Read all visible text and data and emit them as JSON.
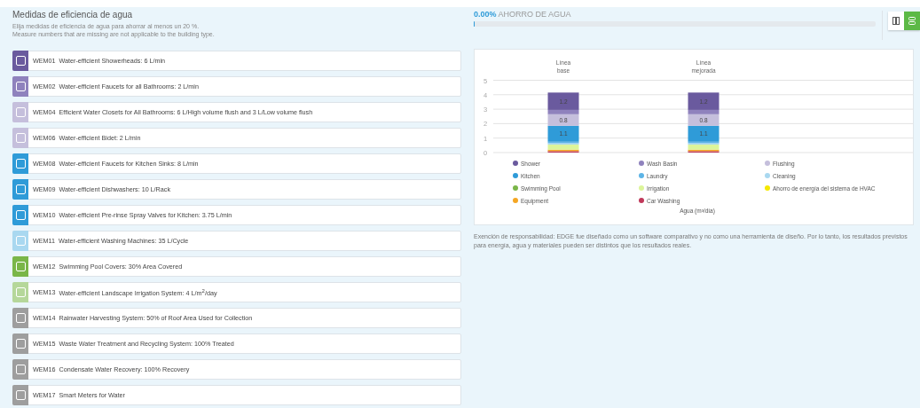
{
  "measures_panel": {
    "title": "Medidas de eficiencia de agua",
    "instructions": [
      "Elija medidas de eficiencia de agua para ahorrar al menos un 20 %.",
      "Measure numbers that are missing are not applicable to the building type."
    ],
    "measures": [
      {
        "code": "WEM01",
        "label": "Water-efficient Showerheads: 6 L/min",
        "checked": false,
        "color": "#6a5a9e"
      },
      {
        "code": "WEM02",
        "label": "Water-efficient Faucets for all Bathrooms: 2 L/min",
        "checked": false,
        "color": "#8f82bd"
      },
      {
        "code": "WEM04",
        "label": "Efficient Water Closets for All Bathrooms: 6 L/High volume flush and 3 L/Low volume flush",
        "checked": false,
        "color": "#c5bfdc"
      },
      {
        "code": "WEM06",
        "label": "Water-efficient Bidet: 2 L/min",
        "checked": false,
        "color": "#c5bfdc"
      },
      {
        "code": "WEM08",
        "label": "Water-efficient Faucets for Kitchen Sinks: 8 L/min",
        "checked": false,
        "color": "#2f9bd8"
      },
      {
        "code": "WEM09",
        "label": "Water-efficient Dishwashers: 10 L/Rack",
        "checked": false,
        "color": "#2f9bd8"
      },
      {
        "code": "WEM10",
        "label": "Water-efficient Pre-rinse Spray Valves for Kitchen: 3.75 L/min",
        "checked": false,
        "color": "#2f9bd8"
      },
      {
        "code": "WEM11",
        "label": "Water-efficient Washing Machines: 35 L/Cycle",
        "checked": false,
        "color": "#a9d8f0"
      },
      {
        "code": "WEM12",
        "label": "Swimming Pool Covers: 30% Area Covered",
        "checked": false,
        "color": "#7ab648"
      },
      {
        "code": "WEM13",
        "label": "Water-efficient Landscape Irrigation System: 4 L/m$^{2}$/day",
        "checked": false,
        "color": "#b5d79a"
      },
      {
        "code": "WEM14",
        "label": "Rainwater Harvesting System: 50% of Roof Area Used for Collection",
        "checked": false,
        "color": "#9e9e9e"
      },
      {
        "code": "WEM15",
        "label": "Waste Water Treatment and Recycling System: 100% Treated",
        "checked": false,
        "color": "#9e9e9e"
      },
      {
        "code": "WEM16",
        "label": "Condensate Water Recovery: 100% Recovery",
        "checked": false,
        "color": "#9e9e9e"
      },
      {
        "code": "WEM17",
        "label": "Smart Meters for Water",
        "checked": false,
        "color": "#9e9e9e"
      }
    ]
  },
  "savings": {
    "percent": "0.00%",
    "label": "AHORRO DE AGUA",
    "level": 0
  },
  "view_toggle": [
    {
      "kind": "columns",
      "selected": false
    },
    {
      "kind": "rows",
      "selected": true
    }
  ],
  "chart_panel": {
    "chart_data": {
      "type": "bar",
      "stacked": true,
      "grid": true,
      "legend": "bottom",
      "annotations": [
        {
          "text": "Agua (m³/día)"
        }
      ],
      "categories": [
        "Línea base",
        "Línea mejorada"
      ],
      "ylim": [
        0,
        5
      ],
      "yticks": [
        0,
        1,
        2,
        3,
        4,
        5
      ],
      "series": [
        {
          "name": "Shower",
          "color": "#6a5a9e",
          "values": [
            1.2,
            1.2
          ]
        },
        {
          "name": "Wash Basin",
          "color": "#8f82bd",
          "values": [
            0.3,
            0.3
          ]
        },
        {
          "name": "Flushing",
          "color": "#c5bfdc",
          "values": [
            0.8,
            0.8
          ]
        },
        {
          "name": "Kitchen",
          "color": "#2f9bd8",
          "values": [
            1.1,
            1.1
          ]
        },
        {
          "name": "Laundry",
          "color": "#5db4e6",
          "values": [
            0.1,
            0.1
          ]
        },
        {
          "name": "Cleaning",
          "color": "#a9d8f0",
          "values": [
            0.1,
            0.1
          ]
        },
        {
          "name": "Swimming Pool",
          "color": "#7ab648",
          "values": [
            0,
            0
          ]
        },
        {
          "name": "Irrigation",
          "color": "#dcf59a",
          "values": [
            0.35,
            0.35
          ]
        },
        {
          "name": "Ahorro de energía del sistema de HVAC",
          "color": "#f5e800",
          "values": [
            0,
            0
          ]
        },
        {
          "name": "Equipment",
          "color": "#f5a623",
          "values": [
            0.1,
            0.1
          ]
        },
        {
          "name": "Car Washing",
          "color": "#c0395a",
          "values": [
            0.1,
            0.1
          ]
        }
      ],
      "value_labels": [
        [
          "1.2",
          "1.2"
        ],
        null,
        [
          "0.8",
          "0.8"
        ],
        [
          "1.1",
          "1.1"
        ],
        null,
        null,
        null,
        null,
        null,
        null,
        null
      ]
    },
    "disclaimer": "Exención de responsabilidad: EDGE fue diseñado como un software comparativo y no como una herramienta de diseño. Por lo tanto, los resultados previstos para energía, agua y materiales pueden ser distintos que los resultados reales."
  }
}
